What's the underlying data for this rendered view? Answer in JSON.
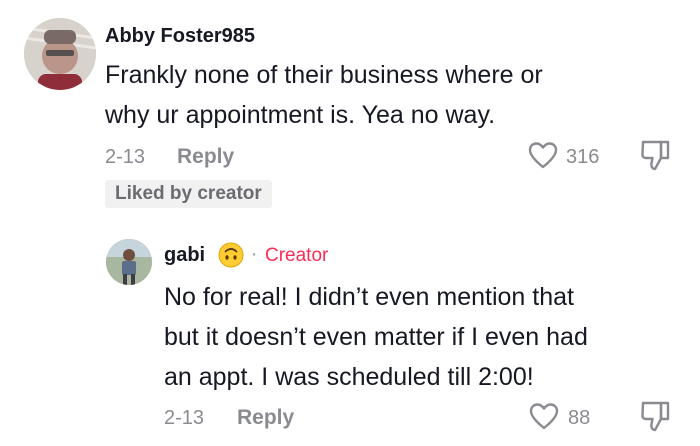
{
  "comments": [
    {
      "username": "Abby Foster985",
      "text_lines": [
        "Frankly none of their business where or",
        "why ur appointment is. Yea no way."
      ],
      "date": "2-13",
      "reply_label": "Reply",
      "like_count": "316",
      "badge": "Liked by creator",
      "icons": {
        "avatar": "user-avatar",
        "like": "heart-icon",
        "dislike": "thumbs-down-icon"
      }
    },
    {
      "username": "gabi",
      "separator": "·",
      "creator_label": "Creator",
      "text_lines": [
        "No for real! I didn’t even mention that",
        "but it doesn’t even matter if I even had",
        "an appt. I was scheduled till 2:00!"
      ],
      "date": "2-13",
      "reply_label": "Reply",
      "like_count": "88",
      "icons": {
        "avatar": "user-avatar",
        "emoji": "upside-down-face-emoji",
        "like": "heart-icon",
        "dislike": "thumbs-down-icon"
      }
    }
  ],
  "colors": {
    "text": "#161823",
    "muted": "#8a8b91",
    "creator": "#fe2c55",
    "badge_bg": "#f1f1f2"
  }
}
